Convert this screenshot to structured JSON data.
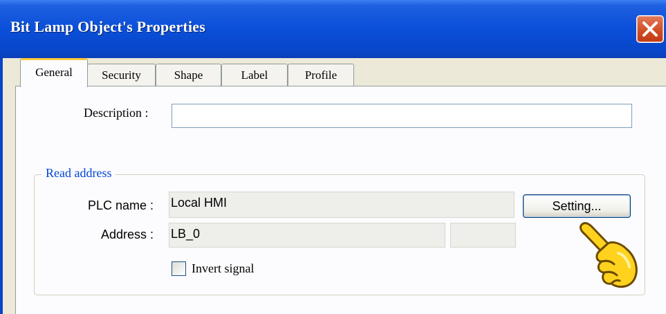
{
  "dialog": {
    "title": "Bit Lamp Object's Properties"
  },
  "tabs": [
    {
      "label": "General",
      "active": true
    },
    {
      "label": "Security",
      "active": false
    },
    {
      "label": "Shape",
      "active": false
    },
    {
      "label": "Label",
      "active": false
    },
    {
      "label": "Profile",
      "active": false
    }
  ],
  "general": {
    "description_label": "Description :",
    "description_value": "",
    "read_address": {
      "title": "Read address",
      "plc_name_label": "PLC name :",
      "plc_name_value": "Local HMI",
      "setting_button": "Setting...",
      "address_label": "Address :",
      "address_value": "LB_0",
      "address_extra_value": "",
      "invert_signal_label": "Invert signal",
      "invert_signal_checked": false
    }
  },
  "colors": {
    "titlebar": "#0a4fd9",
    "group_title": "#0046d5",
    "tab_highlight": "#ffc83c"
  }
}
